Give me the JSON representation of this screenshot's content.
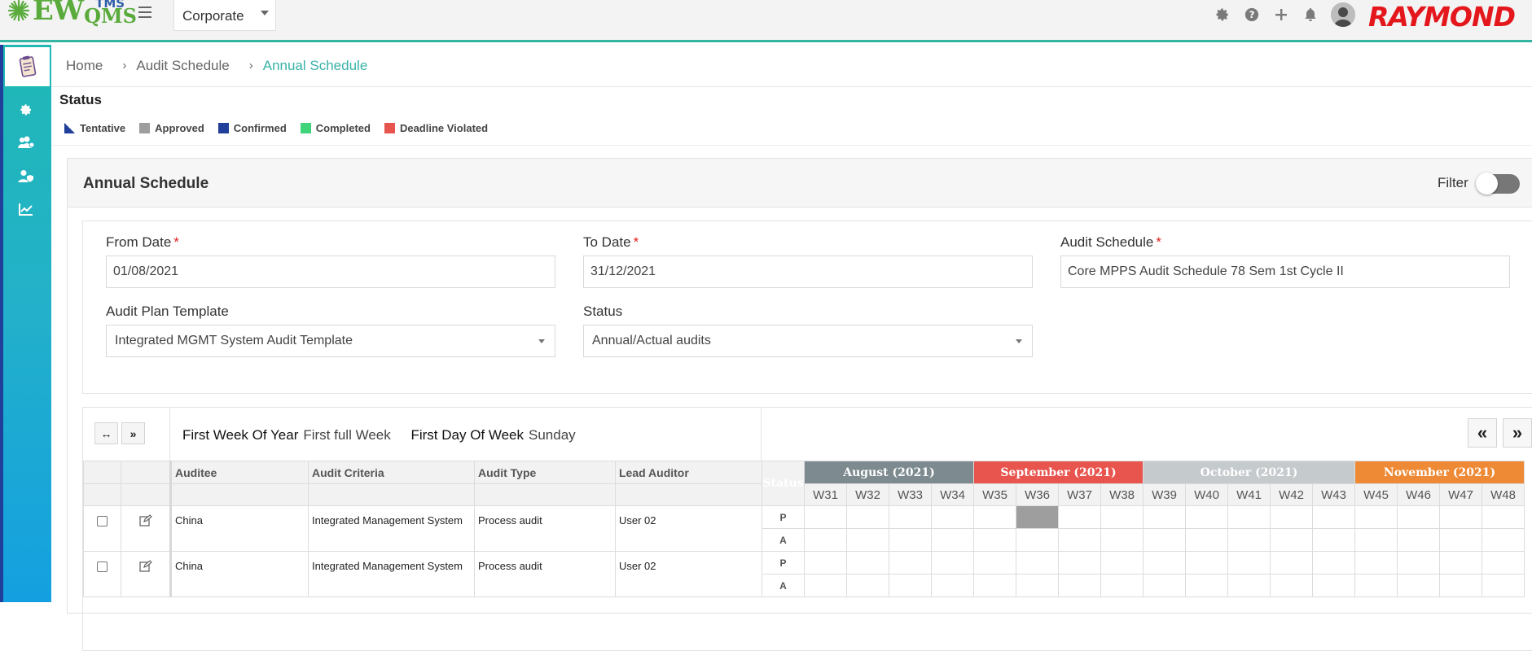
{
  "app": {
    "logo_main": "EW",
    "logo_tms": "TMS",
    "logo_qms": "QMS",
    "brand": "RAYMOND",
    "org_selector": "Corporate"
  },
  "breadcrumb": [
    "Home",
    "Audit Schedule",
    "Annual Schedule"
  ],
  "status": {
    "title": "Status",
    "legend": [
      {
        "label": "Tentative",
        "color": "#1f3f9a",
        "shape": "triangle"
      },
      {
        "label": "Approved",
        "color": "#9e9e9e",
        "shape": "square"
      },
      {
        "label": "Confirmed",
        "color": "#1f3f9a",
        "shape": "square"
      },
      {
        "label": "Completed",
        "color": "#3fd37a",
        "shape": "square"
      },
      {
        "label": "Deadline Violated",
        "color": "#e8544e",
        "shape": "square"
      }
    ]
  },
  "panel": {
    "title": "Annual Schedule",
    "filter_label": "Filter",
    "filter_on": false
  },
  "form": {
    "from_date_label": "From Date",
    "from_date": "01/08/2021",
    "to_date_label": "To Date",
    "to_date": "31/12/2021",
    "audit_schedule_label": "Audit Schedule",
    "audit_schedule": "Core MPPS Audit Schedule 78 Sem 1st Cycle II",
    "template_label": "Audit Plan Template",
    "template": "Integrated MGMT System Audit Template",
    "status_label": "Status",
    "status": "Annual/Actual audits",
    "required_mark": "*"
  },
  "grid": {
    "first_week_label": "First Week Of Year",
    "first_week_value": "First full Week",
    "first_day_label": "First Day Of Week",
    "first_day_value": "Sunday",
    "expand_glyph": "↔",
    "collapse_glyph": "»",
    "prev_glyph": "«",
    "next_glyph": "»",
    "columns": [
      "Auditee",
      "Audit Criteria",
      "Audit Type",
      "Lead Auditor"
    ],
    "status_col": "Status",
    "months": [
      {
        "label": "August (2021)",
        "color": "#7d8a8f",
        "weeks": [
          "W31",
          "W32",
          "W33",
          "W34"
        ]
      },
      {
        "label": "September (2021)",
        "color": "#e8544e",
        "weeks": [
          "W35",
          "W36",
          "W37",
          "W38"
        ]
      },
      {
        "label": "October (2021)",
        "color": "#c5cacc",
        "weeks": [
          "W39",
          "W40",
          "W41",
          "W42",
          "W43"
        ]
      },
      {
        "label": "November (2021)",
        "color": "#ee8a35",
        "weeks": [
          "W45",
          "W46",
          "W47",
          "W48"
        ]
      }
    ],
    "rows": [
      {
        "auditee": "China",
        "criteria": "Integrated Management System",
        "type": "Process audit",
        "lead": "User 02",
        "p_label": "P",
        "a_label": "A",
        "p_marked_week": "W36",
        "p_marked_color": "#9e9e9e"
      },
      {
        "auditee": "China",
        "criteria": "Integrated Management System",
        "type": "Process audit",
        "lead": "User 02",
        "p_label": "P",
        "a_label": "A"
      }
    ]
  }
}
